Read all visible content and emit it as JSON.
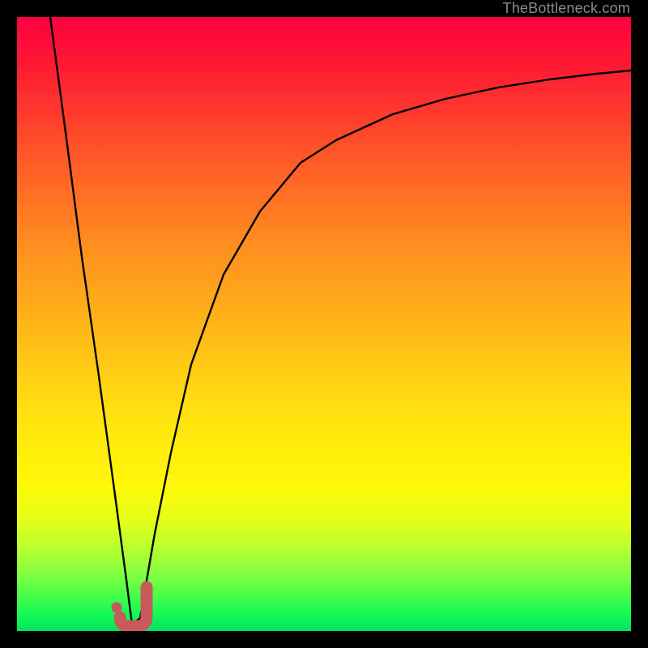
{
  "watermark": "TheBottleneck.com",
  "colors": {
    "frame": "#000000",
    "curve": "#000000",
    "marker": "#c75a5a",
    "watermark_text": "#8a8a8a",
    "gradient_top": "#ff0040",
    "gradient_bottom": "#06e060"
  },
  "chart_data": {
    "type": "line",
    "title": "",
    "xlabel": "",
    "ylabel": "",
    "xlim": [
      0,
      100
    ],
    "ylim": [
      0,
      100
    ],
    "grid": false,
    "legend": false,
    "series": [
      {
        "name": "bottleneck-curve",
        "x": [
          5.4,
          8.0,
          10.6,
          13.2,
          15.8,
          17.8,
          18.8,
          20.0,
          22.4,
          25.0,
          28.3,
          33.6,
          39.5,
          46.1,
          52.0,
          61.2,
          69.8,
          78.3,
          86.8,
          94.5,
          100.0
        ],
        "values": [
          100.0,
          80.2,
          61.0,
          42.5,
          23.1,
          8.3,
          1.0,
          2.0,
          15.8,
          29.0,
          43.4,
          58.0,
          68.4,
          76.3,
          80.0,
          84.2,
          86.7,
          88.5,
          89.9,
          90.8,
          91.3
        ]
      }
    ],
    "annotations": [
      {
        "name": "j-marker",
        "shape": "J",
        "approx_xy_range": {
          "x": [
            17.0,
            21.0
          ],
          "y": [
            0.5,
            7.0
          ]
        }
      },
      {
        "name": "marker-dot",
        "shape": "dot",
        "approx_xy": {
          "x": 16.3,
          "y": 3.8
        }
      }
    ]
  }
}
